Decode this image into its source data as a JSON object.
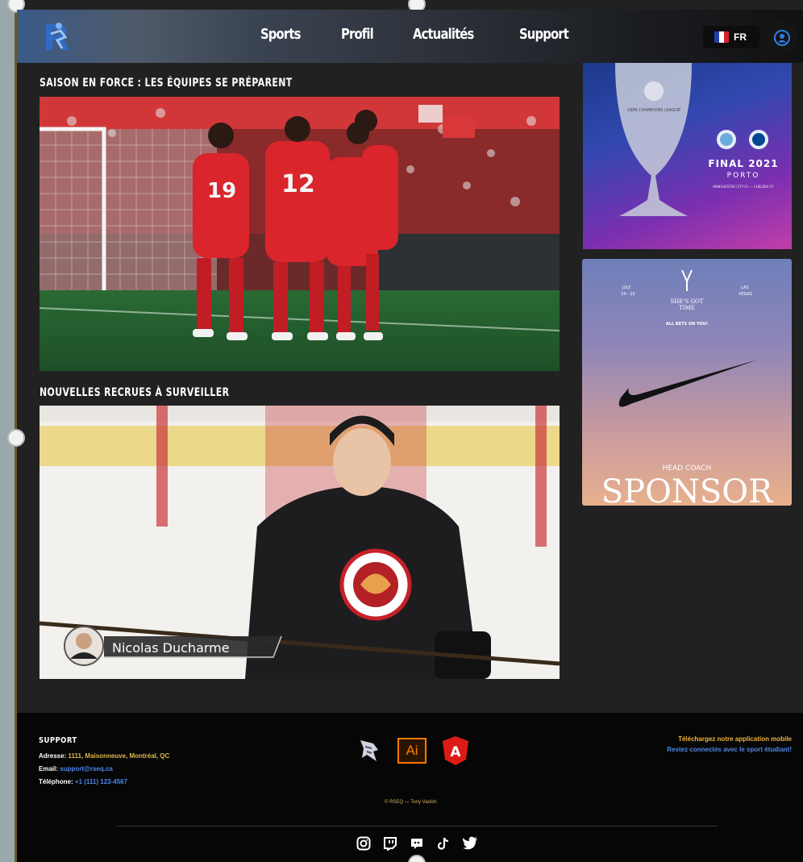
{
  "nav": {
    "items": [
      "Sports",
      "Profil",
      "Actualités",
      "Support"
    ],
    "lang": "FR"
  },
  "sections": {
    "section1_title": "SAISON EN FORCE : LES ÉQUIPES SE PRÉPARENT",
    "section2_title": "NOUVELLES RECRUES À SURVEILLER",
    "player_name": "Nicolas Ducharme",
    "jersey_numbers": [
      "19",
      "12"
    ]
  },
  "ads": {
    "final_title": "FINAL 2021",
    "final_city": "PORTO",
    "final_teams": "MANCHESTER CITY FC — CHELSEA FC",
    "nike_left": "JULY\n14 - 15",
    "nike_right": "LAS\nVEGAS",
    "nike_brand": "SHE'S GOT\nTIME",
    "nike_tagline": "ALL BETS ON YOU!",
    "nike_sub": "HEAD COACH",
    "nike_big": "SPONSOR"
  },
  "footer": {
    "support_heading": "SUPPORT",
    "address_label": "Adresse:",
    "address_value": "1111, Maisonneuve, Montréal, QC",
    "email_label": "Email:",
    "email_value": "support@rseq.ca",
    "phone_label": "Téléphone:",
    "phone_value": "+1 (111) 123-4567",
    "app_line1": "Téléchargez notre application mobile",
    "app_line2": "Restez connectés avec le sport étudiant!",
    "copyright": "© RSEQ — Tony Vadish",
    "tech_icons": [
      "hawk-logo-icon",
      "illustrator-icon",
      "angular-icon"
    ],
    "illustrator_label": "Ai",
    "angular_label": "A",
    "social_icons": [
      "instagram-icon",
      "twitch-icon",
      "discord-icon",
      "tiktok-icon",
      "twitter-icon"
    ]
  },
  "colors": {
    "background": "#212121",
    "footer": "#060606",
    "accent_blue": "#4f87e8",
    "accent_yellow": "#e0b84a"
  }
}
